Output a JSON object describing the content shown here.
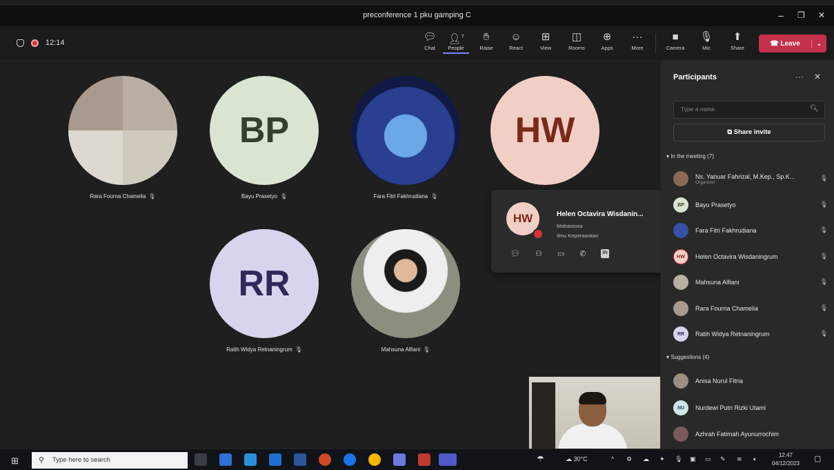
{
  "window": {
    "title": "preconference 1 pku gamping C",
    "minimize": "–",
    "maximize": "❐",
    "close": "✕"
  },
  "toolbar": {
    "elapsed": "12:14",
    "people_count": "7",
    "items": [
      {
        "label": "Chat",
        "icon": "chat-icon"
      },
      {
        "label": "People",
        "icon": "people-icon"
      },
      {
        "label": "Raise",
        "icon": "raise-hand-icon"
      },
      {
        "label": "React",
        "icon": "react-icon"
      },
      {
        "label": "View",
        "icon": "view-icon"
      },
      {
        "label": "Rooms",
        "icon": "rooms-icon"
      },
      {
        "label": "Apps",
        "icon": "apps-icon"
      },
      {
        "label": "More",
        "icon": "more-icon"
      }
    ],
    "camera": "Camera",
    "mic": "Mic",
    "share": "Share",
    "leave": "Leave"
  },
  "tiles": [
    {
      "initials": "",
      "name": "Rara Fourna Chamelia"
    },
    {
      "initials": "BP",
      "name": "Bayu Prasetyo"
    },
    {
      "initials": "",
      "name": "Fara Fitri Fakhrudiana"
    },
    {
      "initials": "HW",
      "name": ""
    },
    {
      "initials": "RR",
      "name": "Ratih Widya Retnaningrum"
    },
    {
      "initials": "",
      "name": "Mahsuna Alfiani"
    }
  ],
  "hovercard": {
    "initials": "HW",
    "name": "Helen Octavira Wisdanin...",
    "role": "Mahasiswa",
    "department": "Ilmu Keperawatan"
  },
  "panel": {
    "title": "Participants",
    "more": "···",
    "close": "✕",
    "search_placeholder": "Type a name",
    "share_invite": "Share invite",
    "in_meeting_label": "In the meeting (7)",
    "suggestions_label": "Suggestions (4)",
    "in_meeting": [
      {
        "initials": "",
        "name": "Ns. Yanuar Fahrizal, M.Kep., Sp.K...",
        "role": "Organizer",
        "color": "#8a6a55"
      },
      {
        "initials": "BP",
        "name": "Bayu Prasetyo",
        "role": "",
        "color": "#d9e4d2"
      },
      {
        "initials": "",
        "name": "Fara Fitri Fakhrudiana",
        "role": "",
        "color": "#3650a8"
      },
      {
        "initials": "HW",
        "name": "Helen Octavira Wisdaningrum",
        "role": "",
        "color": "#f2cfc4"
      },
      {
        "initials": "",
        "name": "Mahsuna Alfiani",
        "role": "",
        "color": "#b8b0a0"
      },
      {
        "initials": "",
        "name": "Rara Fourna Chamelia",
        "role": "",
        "color": "#a89a8f"
      },
      {
        "initials": "RR",
        "name": "Ratih Widya Retnaningrum",
        "role": "",
        "color": "#d7d4ee"
      }
    ],
    "suggestions": [
      {
        "initials": "",
        "name": "Anisa Nurul Fitria",
        "color": "#9a8f80"
      },
      {
        "initials": "NU",
        "name": "Nurdewi Putri Rizki Utami",
        "color": "#cfe6e8"
      },
      {
        "initials": "",
        "name": "Azhrah Fatimah Ayunurrochim",
        "color": "#7a5a5a"
      }
    ]
  },
  "taskbar": {
    "search_placeholder": "Type here to search",
    "temperature": "30°C",
    "time": "12:47",
    "date": "04/12/2023"
  }
}
